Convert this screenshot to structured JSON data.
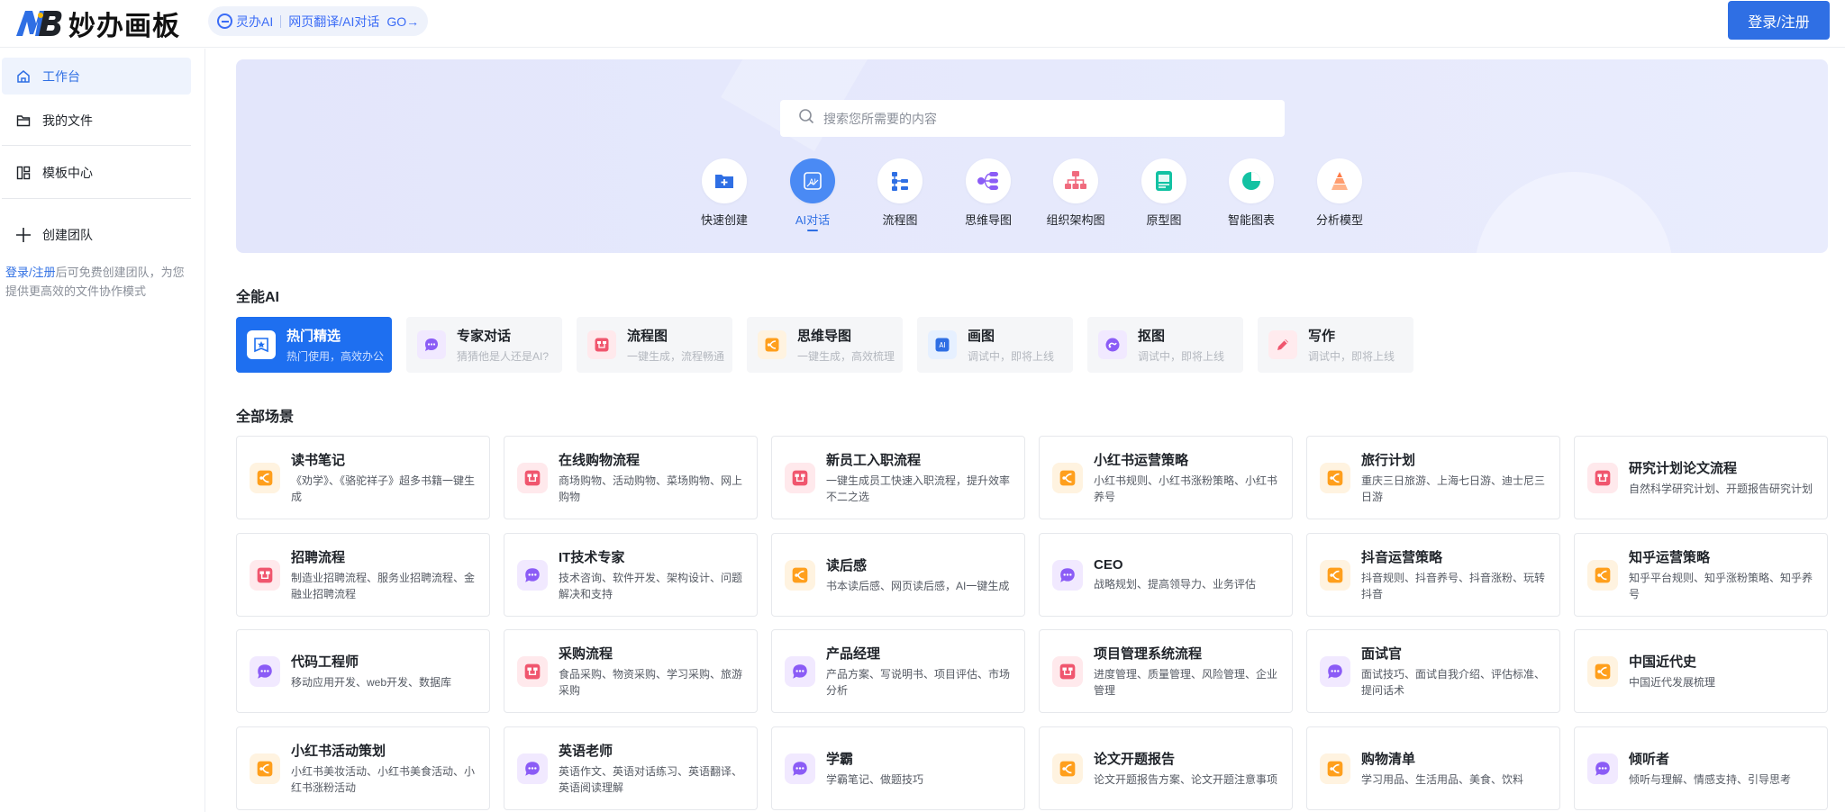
{
  "header": {
    "brand_letters": "MB",
    "brand_name": "妙办画板",
    "promo_product": "灵办AI",
    "promo_text": "网页翻译/AI对话",
    "promo_go": "GO→",
    "login_label": "登录/注册"
  },
  "sidebar": {
    "items": [
      {
        "label": "工作台",
        "icon": "home-icon",
        "active": true
      },
      {
        "label": "我的文件",
        "icon": "folder-icon"
      },
      {
        "label": "模板中心",
        "icon": "template-icon"
      },
      {
        "label": "创建团队",
        "icon": "plus-icon"
      }
    ],
    "note_link": "登录/注册",
    "note_text": "后可免费创建团队，为您提供更高效的文件协作模式"
  },
  "banner": {
    "search_placeholder": "搜索您所需要的内容",
    "quick": [
      {
        "label": "快速创建",
        "icon": "folder-plus-icon"
      },
      {
        "label": "AI对话",
        "icon": "ai-icon",
        "active": true
      },
      {
        "label": "流程图",
        "icon": "flowchart-icon"
      },
      {
        "label": "思维导图",
        "icon": "mindmap-icon"
      },
      {
        "label": "组织架构图",
        "icon": "org-chart-icon"
      },
      {
        "label": "原型图",
        "icon": "prototype-icon"
      },
      {
        "label": "智能图表",
        "icon": "pie-chart-icon"
      },
      {
        "label": "分析模型",
        "icon": "analysis-model-icon"
      }
    ]
  },
  "sections": {
    "all_ai": "全能AI",
    "all_scenes": "全部场景"
  },
  "categories": [
    {
      "name": "热门精选",
      "sub": "热门使用，高效办公",
      "active": true
    },
    {
      "name": "专家对话",
      "sub": "猜猜他是人还是AI?"
    },
    {
      "name": "流程图",
      "sub": "一键生成，流程畅通"
    },
    {
      "name": "思维导图",
      "sub": "一键生成，高效梳理"
    },
    {
      "name": "画图",
      "sub": "调试中，即将上线"
    },
    {
      "name": "抠图",
      "sub": "调试中，即将上线"
    },
    {
      "name": "写作",
      "sub": "调试中，即将上线"
    }
  ],
  "scenes": [
    {
      "name": "读书笔记",
      "desc": "《劝学》、《骆驼祥子》超多书籍一键生成",
      "icon": "mindmap-badge-icon"
    },
    {
      "name": "在线购物流程",
      "desc": "商场购物、活动购物、菜场购物、网上购物",
      "icon": "flowchart-badge-icon"
    },
    {
      "name": "新员工入职流程",
      "desc": "一键生成员工快速入职流程，提升效率不二之选",
      "icon": "flowchart-badge-icon"
    },
    {
      "name": "小红书运营策略",
      "desc": "小红书规则、小红书涨粉策略、小红书养号",
      "icon": "mindmap-badge-icon"
    },
    {
      "name": "旅行计划",
      "desc": "重庆三日旅游、上海七日游、迪士尼三日游",
      "icon": "mindmap-badge-icon"
    },
    {
      "name": "研究计划论文流程",
      "desc": "自然科学研究计划、开题报告研究计划",
      "icon": "flowchart-badge-icon"
    },
    {
      "name": "招聘流程",
      "desc": "制造业招聘流程、服务业招聘流程、金融业招聘流程",
      "icon": "flowchart-badge-icon"
    },
    {
      "name": "IT技术专家",
      "desc": "技术咨询、软件开发、架构设计、问题解决和支持",
      "icon": "chat-badge-icon"
    },
    {
      "name": "读后感",
      "desc": "书本读后感、网页读后感，AI一键生成",
      "icon": "mindmap-badge-icon"
    },
    {
      "name": "CEO",
      "desc": "战略规划、提高领导力、业务评估",
      "icon": "chat-badge-icon"
    },
    {
      "name": "抖音运营策略",
      "desc": "抖音规则、抖音养号、抖音涨粉、玩转抖音",
      "icon": "mindmap-badge-icon"
    },
    {
      "name": "知乎运营策略",
      "desc": "知乎平台规则、知乎涨粉策略、知乎养号",
      "icon": "mindmap-badge-icon"
    },
    {
      "name": "代码工程师",
      "desc": "移动应用开发、web开发、数据库",
      "icon": "chat-badge-icon"
    },
    {
      "name": "采购流程",
      "desc": "食品采购、物资采购、学习采购、旅游采购",
      "icon": "flowchart-badge-icon"
    },
    {
      "name": "产品经理",
      "desc": "产品方案、写说明书、项目评估、市场分析",
      "icon": "chat-badge-icon"
    },
    {
      "name": "项目管理系统流程",
      "desc": "进度管理、质量管理、风险管理、企业管理",
      "icon": "flowchart-badge-icon"
    },
    {
      "name": "面试官",
      "desc": "面试技巧、面试自我介绍、评估标准、提问话术",
      "icon": "chat-badge-icon"
    },
    {
      "name": "中国近代史",
      "desc": "中国近代发展梳理",
      "icon": "mindmap-badge-icon"
    },
    {
      "name": "小红书活动策划",
      "desc": "小红书美妆活动、小红书美食活动、小红书涨粉活动",
      "icon": "mindmap-badge-icon"
    },
    {
      "name": "英语老师",
      "desc": "英语作文、英语对话练习、英语翻译、英语阅读理解",
      "icon": "chat-badge-icon"
    },
    {
      "name": "学霸",
      "desc": "学霸笔记、做题技巧",
      "icon": "chat-badge-icon"
    },
    {
      "name": "论文开题报告",
      "desc": "论文开题报告方案、论文开题注意事项",
      "icon": "mindmap-badge-icon"
    },
    {
      "name": "购物清单",
      "desc": "学习用品、生活用品、美食、饮料",
      "icon": "mindmap-badge-icon"
    },
    {
      "name": "倾听者",
      "desc": "倾听与理解、情感支持、引导思考",
      "icon": "chat-badge-icon"
    }
  ]
}
